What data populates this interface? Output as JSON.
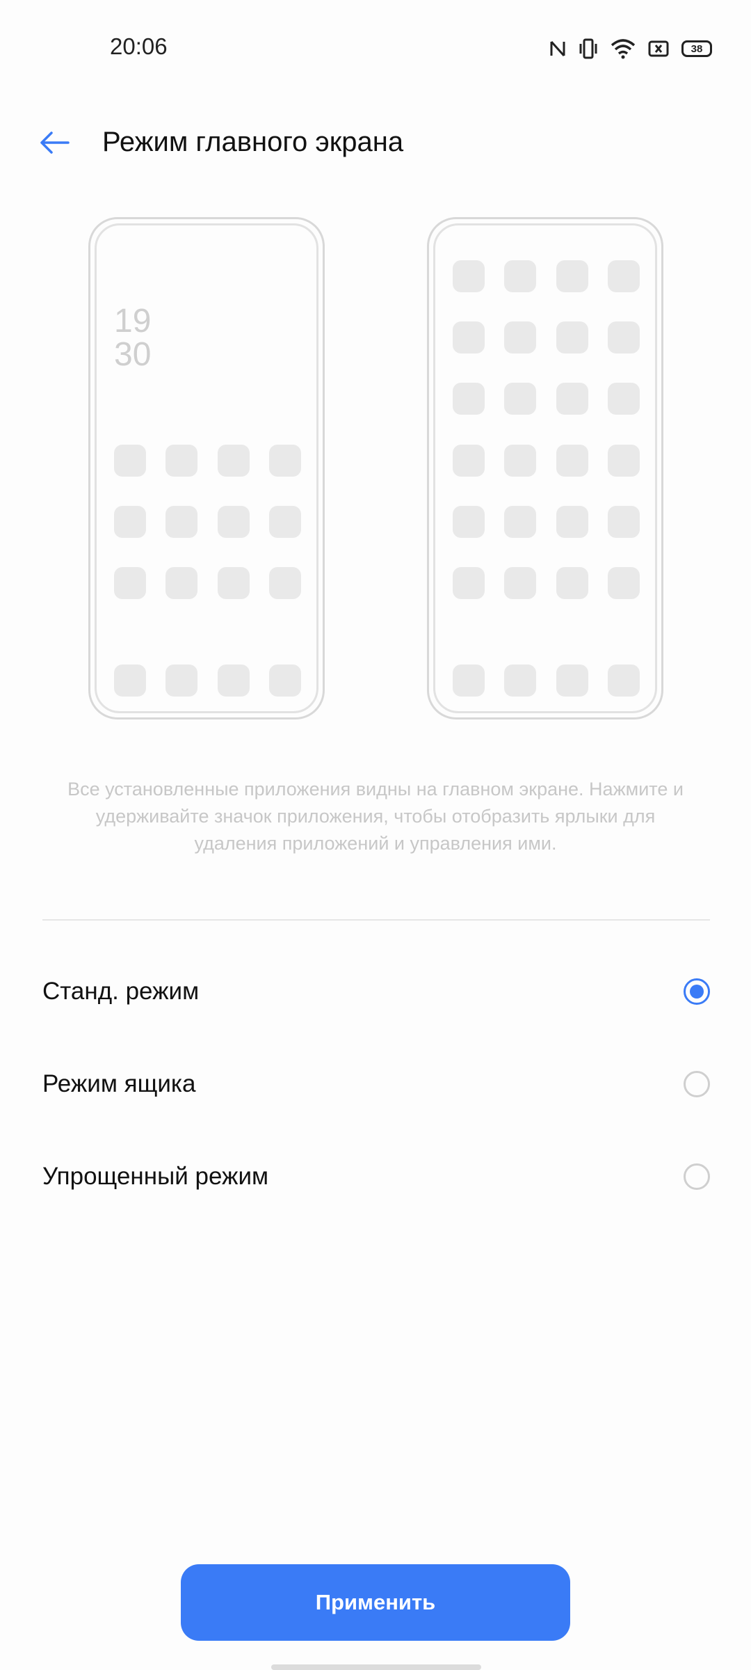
{
  "status_bar": {
    "time": "20:06",
    "battery": "38",
    "icons": [
      "nfc-icon",
      "vibrate-icon",
      "wifi-icon",
      "sim-off-icon",
      "battery-icon"
    ]
  },
  "header": {
    "title": "Режим главного экрана",
    "back_icon": "arrow-left-icon"
  },
  "preview_standard": {
    "clock_hours": "19",
    "clock_minutes": "30"
  },
  "description": "Все установленные приложения видны на главном экране. Нажмите и удерживайте значок приложения, чтобы отобразить ярлыки для удаления приложений и управления ими.",
  "options": [
    {
      "label": "Станд. режим",
      "selected": true
    },
    {
      "label": "Режим ящика",
      "selected": false
    },
    {
      "label": "Упрощенный режим",
      "selected": false
    }
  ],
  "apply_button": {
    "label": "Применить"
  },
  "colors": {
    "accent": "#3a7bf6",
    "text": "#111111",
    "muted": "#c7c7c7"
  }
}
